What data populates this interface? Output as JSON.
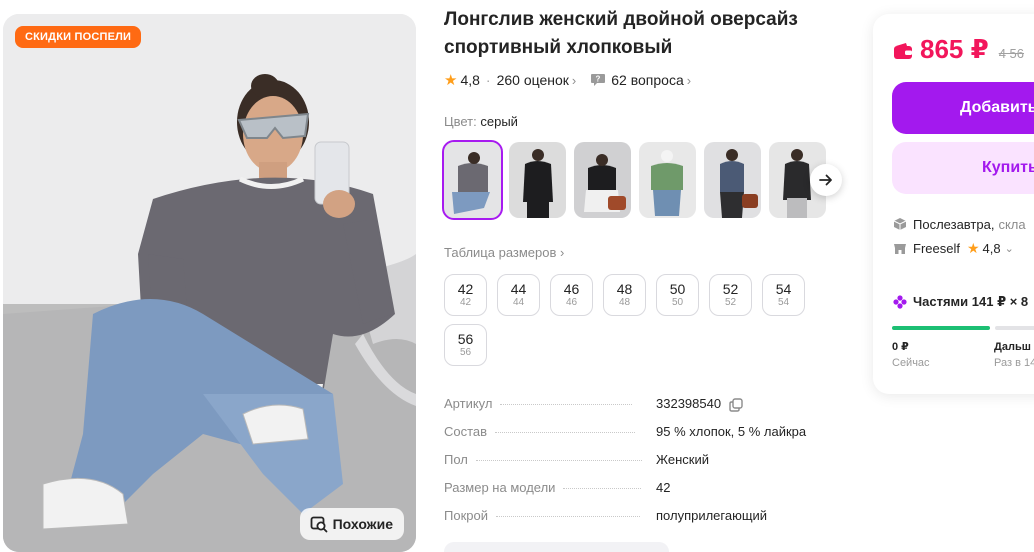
{
  "photo": {
    "badge": "СКИДКИ ПОСПЕЛИ",
    "similar_label": "Похожие"
  },
  "product": {
    "title": "Лонгслив женский двойной оверсайз спортивный хлопковый",
    "rating": "4,8",
    "reviews": "260 оценок",
    "questions": "62 вопроса"
  },
  "color": {
    "label": "Цвет:",
    "value": "серый",
    "thumbnails": [
      "grey",
      "black",
      "black-white",
      "green",
      "blue",
      "black-long"
    ]
  },
  "sizes": {
    "table_link": "Таблица размеров",
    "items": [
      {
        "ru": "42",
        "sub": "42"
      },
      {
        "ru": "44",
        "sub": "44"
      },
      {
        "ru": "46",
        "sub": "46"
      },
      {
        "ru": "48",
        "sub": "48"
      },
      {
        "ru": "50",
        "sub": "50"
      },
      {
        "ru": "52",
        "sub": "52"
      },
      {
        "ru": "54",
        "sub": "54"
      },
      {
        "ru": "56",
        "sub": "56"
      }
    ]
  },
  "specs": [
    {
      "key": "Артикул",
      "value": "332398540"
    },
    {
      "key": "Состав",
      "value": "95 % хлопок, 5 % лайкра"
    },
    {
      "key": "Пол",
      "value": "Женский"
    },
    {
      "key": "Размер на модели",
      "value": "42"
    },
    {
      "key": "Покрой",
      "value": "полуприлегающий"
    }
  ],
  "buy": {
    "price": "865 ₽",
    "old_price": "4 56",
    "add_label": "Добавить",
    "buy_label": "Купить",
    "delivery": "Послезавтра,",
    "delivery_more": "скла",
    "seller": "Freeself",
    "seller_rating": "4,8",
    "installment": "Частями 141 ₽ × 8",
    "first_amount": "0 ₽",
    "first_when": "Сейчас",
    "next_amount": "Дальш",
    "next_when": "Раз в 14"
  },
  "colors": {
    "accent": "#a319ee",
    "price": "#f2165b",
    "badge": "#ff6a13",
    "star": "#ff9e1b",
    "progress": "#1cbf73"
  }
}
